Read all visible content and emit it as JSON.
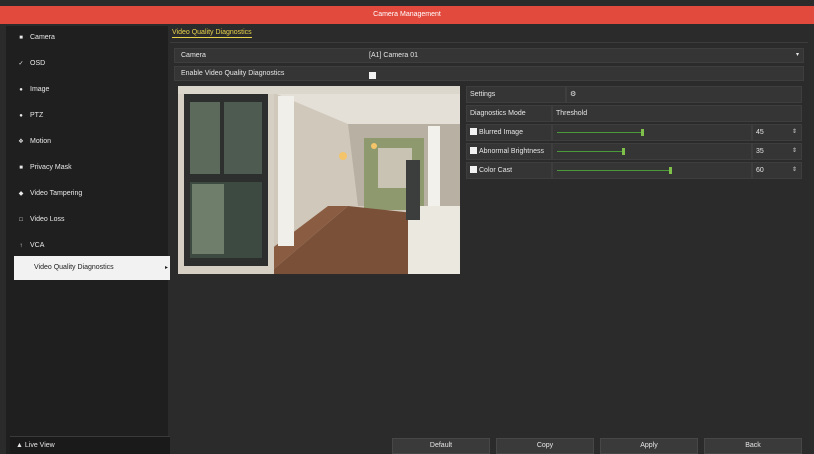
{
  "window": {
    "title": "Camera Management"
  },
  "sidebar": {
    "items": [
      {
        "label": "Camera",
        "icon": "camera-icon"
      },
      {
        "label": "OSD",
        "icon": "brush-icon"
      },
      {
        "label": "Image",
        "icon": "image-icon"
      },
      {
        "label": "PTZ",
        "icon": "ptz-icon"
      },
      {
        "label": "Motion",
        "icon": "motion-icon"
      },
      {
        "label": "Privacy Mask",
        "icon": "privacy-mask-icon"
      },
      {
        "label": "Video Tampering",
        "icon": "tampering-icon"
      },
      {
        "label": "Video Loss",
        "icon": "video-loss-icon"
      },
      {
        "label": "VCA",
        "icon": "vca-icon"
      },
      {
        "label": "Video Quality Diagnostics",
        "icon": "",
        "active": true
      }
    ],
    "live_view": "Live View"
  },
  "main": {
    "tab": "Video Quality Diagnostics",
    "camera_label": "Camera",
    "camera_value": "[A1] Camera 01",
    "enable_label": "Enable Video Quality Diagnostics",
    "settings_label": "Settings",
    "diag_mode_label": "Diagnostics Mode",
    "threshold_label": "Threshold",
    "diagnostics": [
      {
        "label": "Blurred Image",
        "value": "45",
        "level": 0.45
      },
      {
        "label": "Abnormal Brightness",
        "value": "35",
        "level": 0.35
      },
      {
        "label": "Color Cast",
        "value": "60",
        "level": 0.6
      }
    ]
  },
  "buttons": {
    "default": "Default",
    "copy": "Copy",
    "apply": "Apply",
    "back": "Back"
  },
  "colors": {
    "accent": "#e34a3e",
    "tab": "#e8d24a",
    "slider": "#4a9a3a"
  }
}
